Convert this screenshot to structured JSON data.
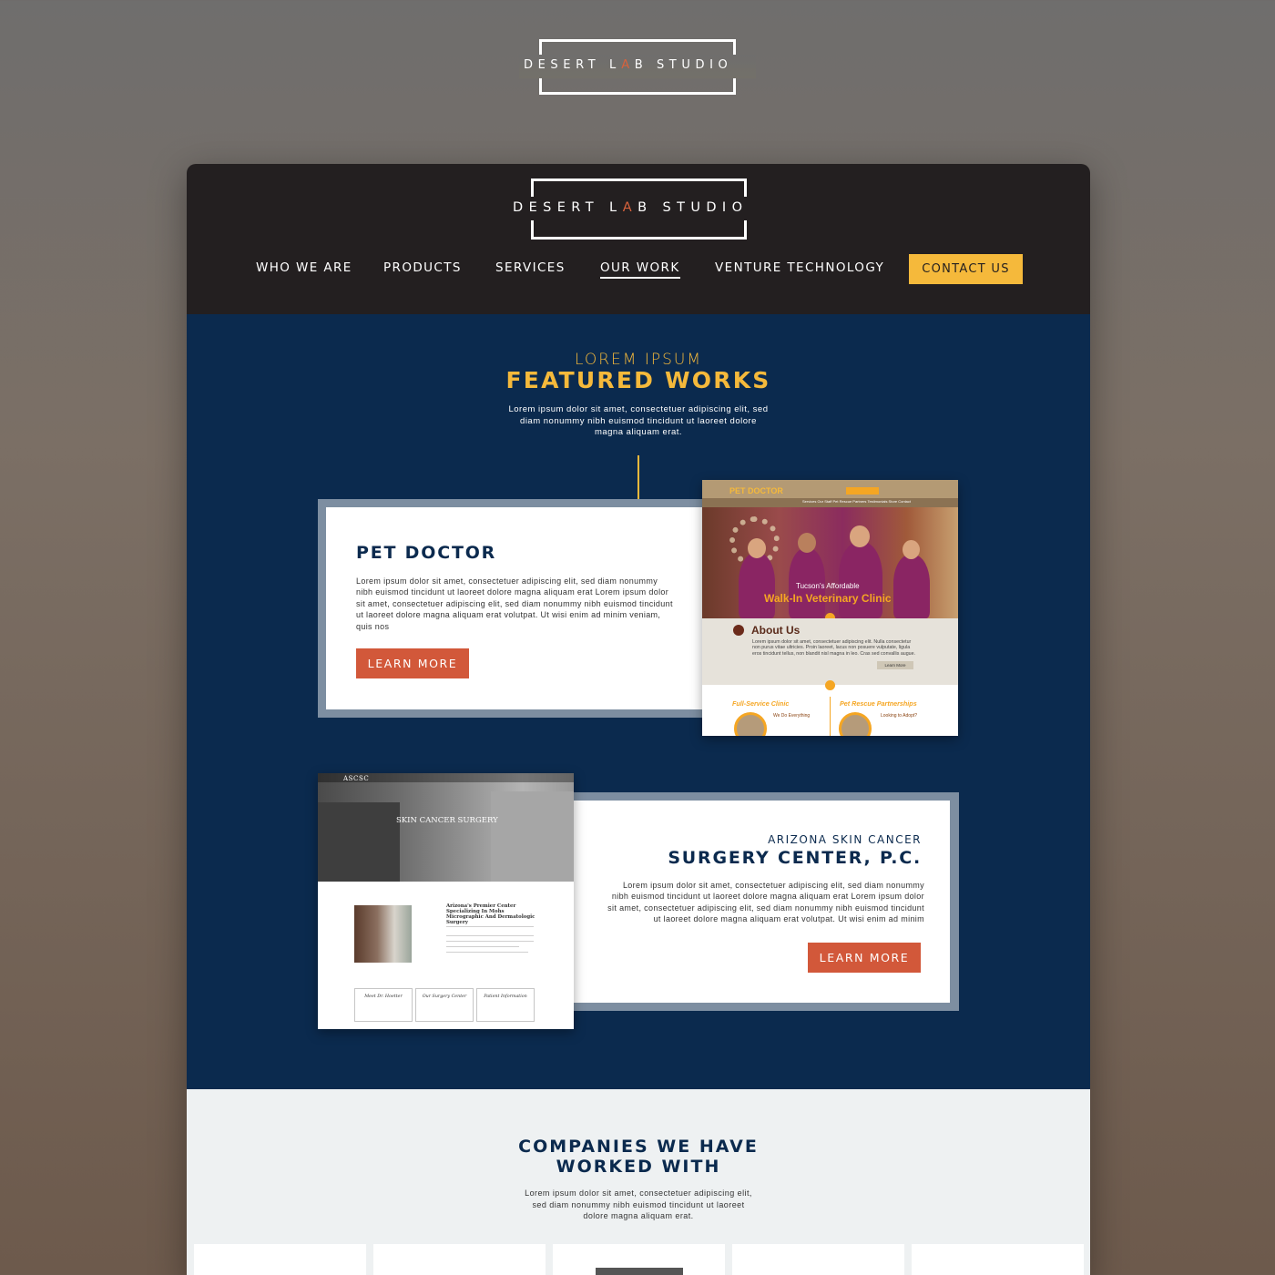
{
  "brand": {
    "logo_part1": "DESERT L",
    "logo_accent": "A",
    "logo_part2": "B STUDIO"
  },
  "nav": {
    "items": [
      {
        "label": "WHO WE ARE"
      },
      {
        "label": "PRODUCTS"
      },
      {
        "label": "SERVICES"
      },
      {
        "label": "OUR WORK",
        "active": true
      },
      {
        "label": "VENTURE TECHNOLOGY"
      }
    ],
    "cta": "CONTACT US"
  },
  "featured": {
    "eyebrow": "LOREM IPSUM",
    "title": "FEATURED WORKS",
    "intro": "Lorem ipsum dolor sit amet, consectetuer adipiscing elit, sed diam nonummy nibh euismod tincidunt ut laoreet dolore magna aliquam erat."
  },
  "works": [
    {
      "title": "PET DOCTOR",
      "body": "Lorem ipsum dolor sit amet, consectetuer adipiscing elit, sed diam nonummy nibh euismod tincidunt ut laoreet dolore magna aliquam erat Lorem ipsum dolor sit amet, consectetuer adipiscing elit, sed diam nonummy nibh euismod tincidunt ut laoreet dolore magna aliquam erat volutpat. Ut wisi enim ad minim veniam, quis nos",
      "button": "LEARN MORE"
    },
    {
      "subtitle": "ARIZONA SKIN CANCER",
      "title": "SURGERY CENTER, P.C.",
      "body": "Lorem ipsum dolor sit amet, consectetuer adipiscing elit, sed diam nonummy nibh euismod tincidunt ut laoreet dolore magna aliquam erat Lorem ipsum dolor sit amet, consectetuer adipiscing elit, sed diam nonummy nibh euismod tincidunt ut laoreet dolore magna aliquam erat volutpat. Ut wisi enim ad minim",
      "button": "LEARN MORE"
    }
  ],
  "pet_preview": {
    "logo": "PET DOCTOR",
    "hero_small": "Tucson's Affordable",
    "hero_big": "Walk-In Veterinary Clinic",
    "about_title": "About Us",
    "about_body": "Lorem ipsum dolor sit amet, consectetuer adipiscing elit. Nulla consectetur non purus vitae ultricies. Proin laoreet, lacus non posuere vulputate, ligula eros tincidunt tellus, non blandit nisl magna in leo. Cras sed convallis augue.",
    "about_button": "Learn More",
    "col1_title": "Full-Service Clinic",
    "col1_sub": "We Do Everything",
    "col2_title": "Pet Rescue Partnerships",
    "col2_sub": "Looking to Adopt?",
    "nav_text": "Services  Our Staff  Pet Rescue Partners  Testimonials  Store  Contact"
  },
  "ascsc_preview": {
    "logo": "ASCSC",
    "hero_text": "SKIN CANCER SURGERY",
    "heading": "Arizona's Premier Center Specializing In Mohs Micrographic And Dermatologic Surgery",
    "boxes": [
      "Meet Dr. Hoetter",
      "Our Surgery Center",
      "Patient Information"
    ]
  },
  "companies": {
    "title_line1": "COMPANIES WE HAVE",
    "title_line2": "WORKED WITH",
    "intro": "Lorem ipsum dolor sit amet, consectetuer adipiscing elit, sed diam nonummy nibh euismod tincidunt ut laoreet dolore magna aliquam erat."
  },
  "colors": {
    "navy": "#0b2a4e",
    "gold": "#f5b93b",
    "orange": "#d2583a",
    "header_dark": "#231f20"
  }
}
